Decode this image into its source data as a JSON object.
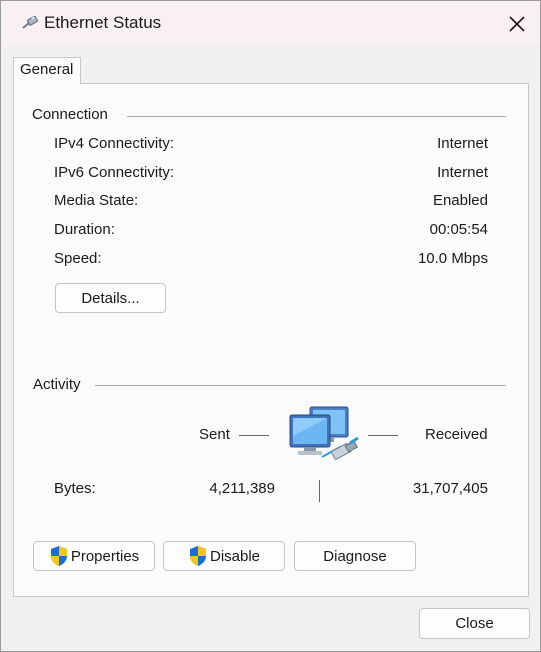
{
  "window": {
    "title": "Ethernet Status",
    "close_glyph": "✕"
  },
  "tabs": [
    {
      "label": "General"
    }
  ],
  "connection": {
    "title": "Connection",
    "rows": [
      {
        "label": "IPv4 Connectivity:",
        "value": "Internet"
      },
      {
        "label": "IPv6 Connectivity:",
        "value": "Internet"
      },
      {
        "label": "Media State:",
        "value": "Enabled"
      },
      {
        "label": "Duration:",
        "value": "00:05:54"
      },
      {
        "label": "Speed:",
        "value": "10.0 Mbps"
      }
    ],
    "details_button": "Details..."
  },
  "activity": {
    "title": "Activity",
    "sent_label": "Sent",
    "received_label": "Received",
    "bytes_label": "Bytes:",
    "bytes_sent": "4,211,389",
    "bytes_received": "31,707,405"
  },
  "buttons": {
    "properties": "Properties",
    "disable": "Disable",
    "diagnose": "Diagnose",
    "close": "Close"
  },
  "icons": {
    "title": "ethernet-cable-icon",
    "shield": "uac-shield-icon",
    "activity": "network-computers-icon"
  },
  "colors": {
    "titlebar": "#f9f0f4",
    "panel": "#fbfbfb",
    "background": "#f0f0f0",
    "shield_blue": "#1a6fd6",
    "shield_yellow": "#f5c518"
  }
}
